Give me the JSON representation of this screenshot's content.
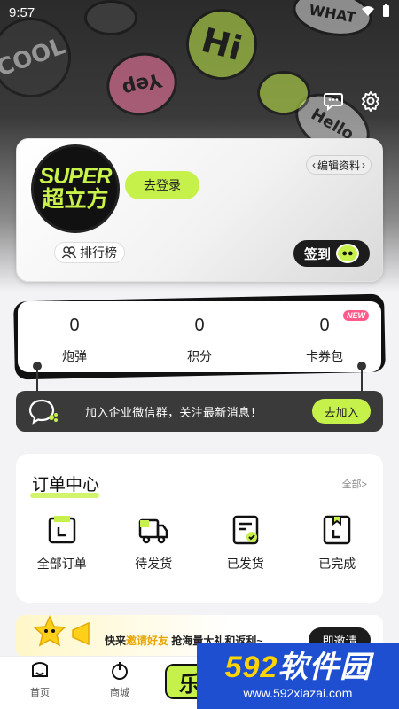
{
  "status_bar": {
    "time": "9:57"
  },
  "header": {
    "sticker_words": [
      "COOL",
      "Hi",
      "Hello",
      "WHAT",
      "Yep"
    ]
  },
  "profile": {
    "avatar_text_top": "SUPER",
    "avatar_text_bottom": "超立方",
    "login_label": "去登录",
    "edit_label": "编辑资料",
    "rank_label": "排行榜",
    "checkin_label": "签到"
  },
  "stats": [
    {
      "value": "0",
      "label": "炮弹"
    },
    {
      "value": "0",
      "label": "积分"
    },
    {
      "value": "0",
      "label": "卡券包",
      "badge": "NEW"
    }
  ],
  "wechat": {
    "text": "加入企业微信群，关注最新消息！",
    "button": "去加入"
  },
  "orders": {
    "title": "订单中心",
    "all_label": "全部>",
    "items": [
      {
        "label": "全部订单",
        "icon": "all-orders-icon"
      },
      {
        "label": "待发货",
        "icon": "truck-icon"
      },
      {
        "label": "已发货",
        "icon": "shipped-icon"
      },
      {
        "label": "已完成",
        "icon": "completed-icon"
      }
    ]
  },
  "invite": {
    "text_pre": "快来",
    "text_highlight": "邀请好友",
    "text_post": " 抢海量大礼和返利~",
    "button": "即邀请"
  },
  "nav": {
    "items": [
      {
        "label": "首页",
        "icon": "home-icon"
      },
      {
        "label": "商城",
        "icon": "shop-icon"
      }
    ],
    "center_label": "乐"
  },
  "watermark": {
    "top_colored": "592",
    "top_white": "软件园",
    "bottom": "www.592xiazai.com"
  },
  "colors": {
    "accent": "#c6f04a",
    "dark": "#1c1c1c",
    "badge": "#ff5b8a",
    "watermark_bg": "#1e4fd0"
  }
}
